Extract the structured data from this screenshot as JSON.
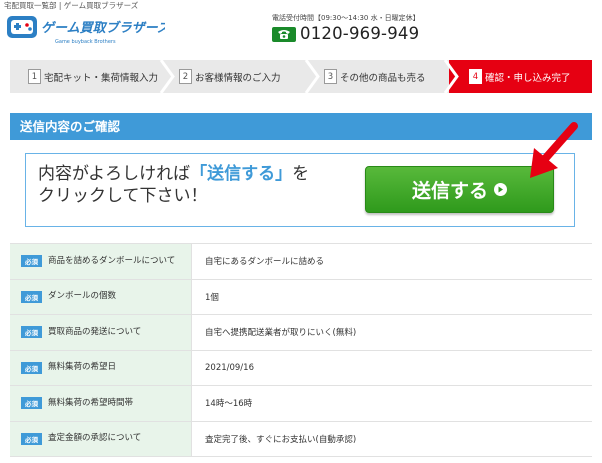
{
  "breadcrumb": "宅配買取一覧部 | ゲーム買取ブラザーズ",
  "logo": {
    "name": "ゲーム買取ブラザーズ",
    "tagline": "Game buyback Brothers"
  },
  "contact": {
    "hours": "電話受付時間【09:30〜14:30 水・日曜定休】",
    "phone": "0120-969-949"
  },
  "steps": [
    {
      "num": "1",
      "label": "宅配キット・集荷情報入力",
      "active": false
    },
    {
      "num": "2",
      "label": "お客様情報のご入力",
      "active": false
    },
    {
      "num": "3",
      "label": "その他の商品も売る",
      "active": false
    },
    {
      "num": "4",
      "label": "確認・申し込み完了",
      "active": true
    }
  ],
  "section": {
    "title": "送信内容のご確認"
  },
  "confirm": {
    "text_before": "内容がよろしければ",
    "text_highlight": "「送信する」",
    "text_after": "を",
    "text_line2": "クリックして下さい！",
    "button_label": "送信する"
  },
  "table": {
    "badge": "必須",
    "rows": [
      {
        "label": "商品を詰めるダンボールについて",
        "value": "自宅にあるダンボールに詰める"
      },
      {
        "label": "ダンボールの個数",
        "value": "1個"
      },
      {
        "label": "買取商品の発送について",
        "value": "自宅へ提携配送業者が取りにいく(無料)"
      },
      {
        "label": "無料集荷の希望日",
        "value": "2021/09/16"
      },
      {
        "label": "無料集荷の希望時間帯",
        "value": "14時～16時"
      },
      {
        "label": "査定金額の承認について",
        "value": "査定完了後、すぐにお支払い(自動承認)"
      }
    ]
  },
  "colors": {
    "accent": "#3f9ad8",
    "active_step": "#e60012",
    "button": "#3aa524",
    "label_bg": "#e8f4ea"
  }
}
